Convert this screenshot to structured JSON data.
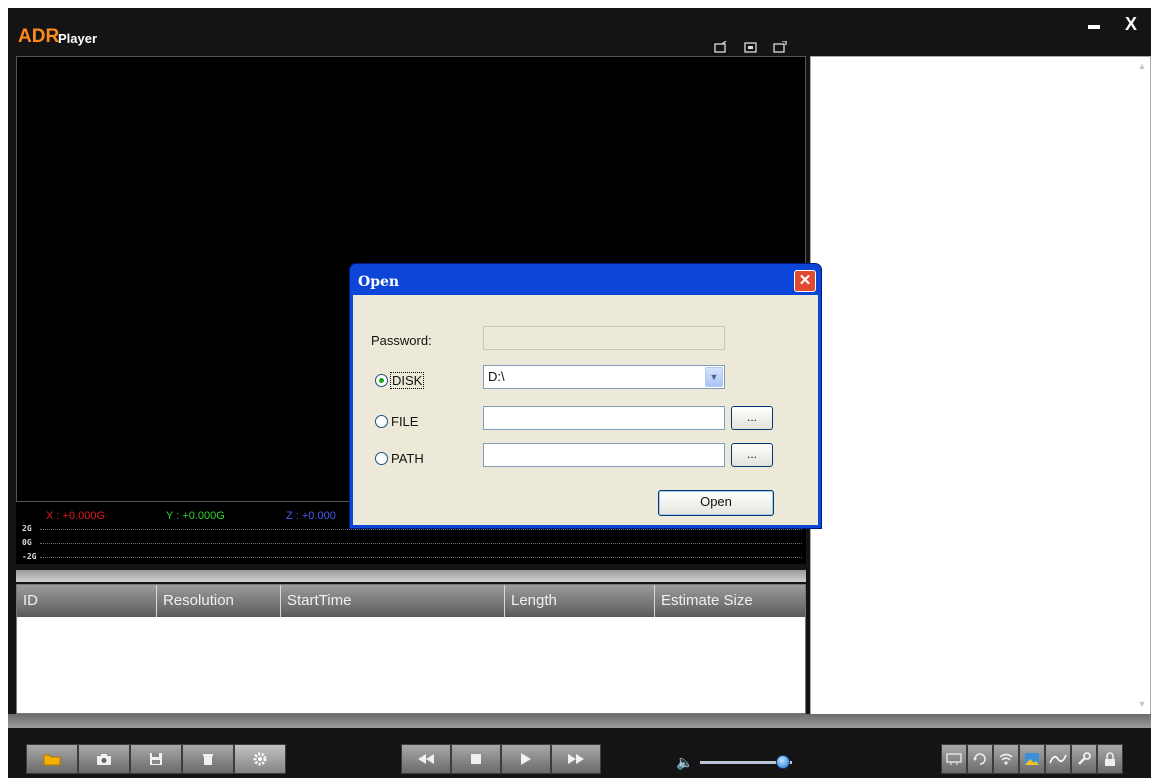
{
  "app": {
    "logo": "ADR",
    "name": "Player",
    "close_glyph": "X"
  },
  "gsensor": {
    "x": "X : +0.000G",
    "y": "Y : +0.000G",
    "z": "Z : +0.000",
    "ticks": [
      "2G",
      "0G",
      "-2G"
    ]
  },
  "table": {
    "columns": [
      "ID",
      "Resolution",
      "StartTime",
      "Length",
      "Estimate Size"
    ]
  },
  "volume": {
    "level": 0.9
  },
  "dialog": {
    "title": "Open",
    "password_label": "Password:",
    "password_value": "",
    "disk_label": "DISK",
    "disk_value": "D:\\",
    "file_label": "FILE",
    "file_value": "",
    "path_label": "PATH",
    "path_value": "",
    "browse_label": "...",
    "open_label": "Open",
    "selected_source": "DISK"
  },
  "colors": {
    "logo": "#ff8a1a",
    "g_x": "#e01818",
    "g_y": "#2ed12e",
    "g_z": "#4a5cf0",
    "dialog_frame": "#0b46d8"
  },
  "icons": {
    "view_buttons": [
      "view-single-icon",
      "view-split-icon",
      "view-fullscreen-icon"
    ],
    "file_tools": [
      "folder-icon",
      "camera-icon",
      "save-icon",
      "trash-icon",
      "settings-icon"
    ],
    "playback": [
      "rewind-icon",
      "stop-icon",
      "play-icon",
      "fast-forward-icon"
    ],
    "right_tools": [
      "map-icon",
      "rotate-180-icon",
      "wifi-icon",
      "photo-icon",
      "graph-icon",
      "wrench-icon",
      "lock-icon"
    ]
  }
}
